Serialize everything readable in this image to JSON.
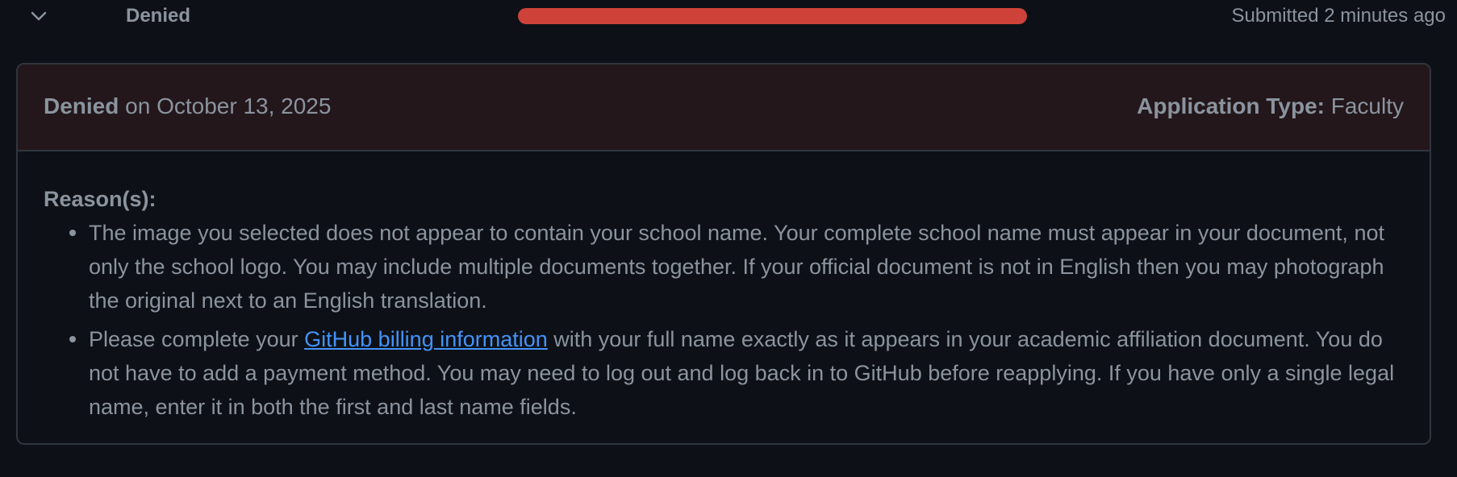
{
  "status_row": {
    "status": "Denied",
    "progress": 1.0,
    "submitted": "Submitted 2 minutes ago"
  },
  "card": {
    "header": {
      "status_word": "Denied",
      "date_text": " on October 13, 2025",
      "app_type_label": "Application Type:",
      "app_type_value": " Faculty"
    },
    "reasons_title": "Reason(s):",
    "reason_1": "The image you selected does not appear to contain your school name. Your complete school name must appear in your document, not only the school logo. You may include multiple documents together. If your official document is not in English then you may photograph the original next to an English translation.",
    "reason_2": {
      "before": "Please complete your ",
      "link": "GitHub billing information",
      "after": " with your full name exactly as it appears in your academic affiliation document. You do not have to add a payment method. You may need to log out and log back in to GitHub before reapplying. If you have only a single legal name, enter it in both the first and last name fields."
    }
  },
  "colors": {
    "background": "#0d1117",
    "header_bg": "#23171b",
    "denied_red": "#cf4239",
    "link_blue": "#4493f8",
    "text_muted": "#8b949e"
  },
  "icons": {
    "expand": "chevron-down-icon"
  }
}
